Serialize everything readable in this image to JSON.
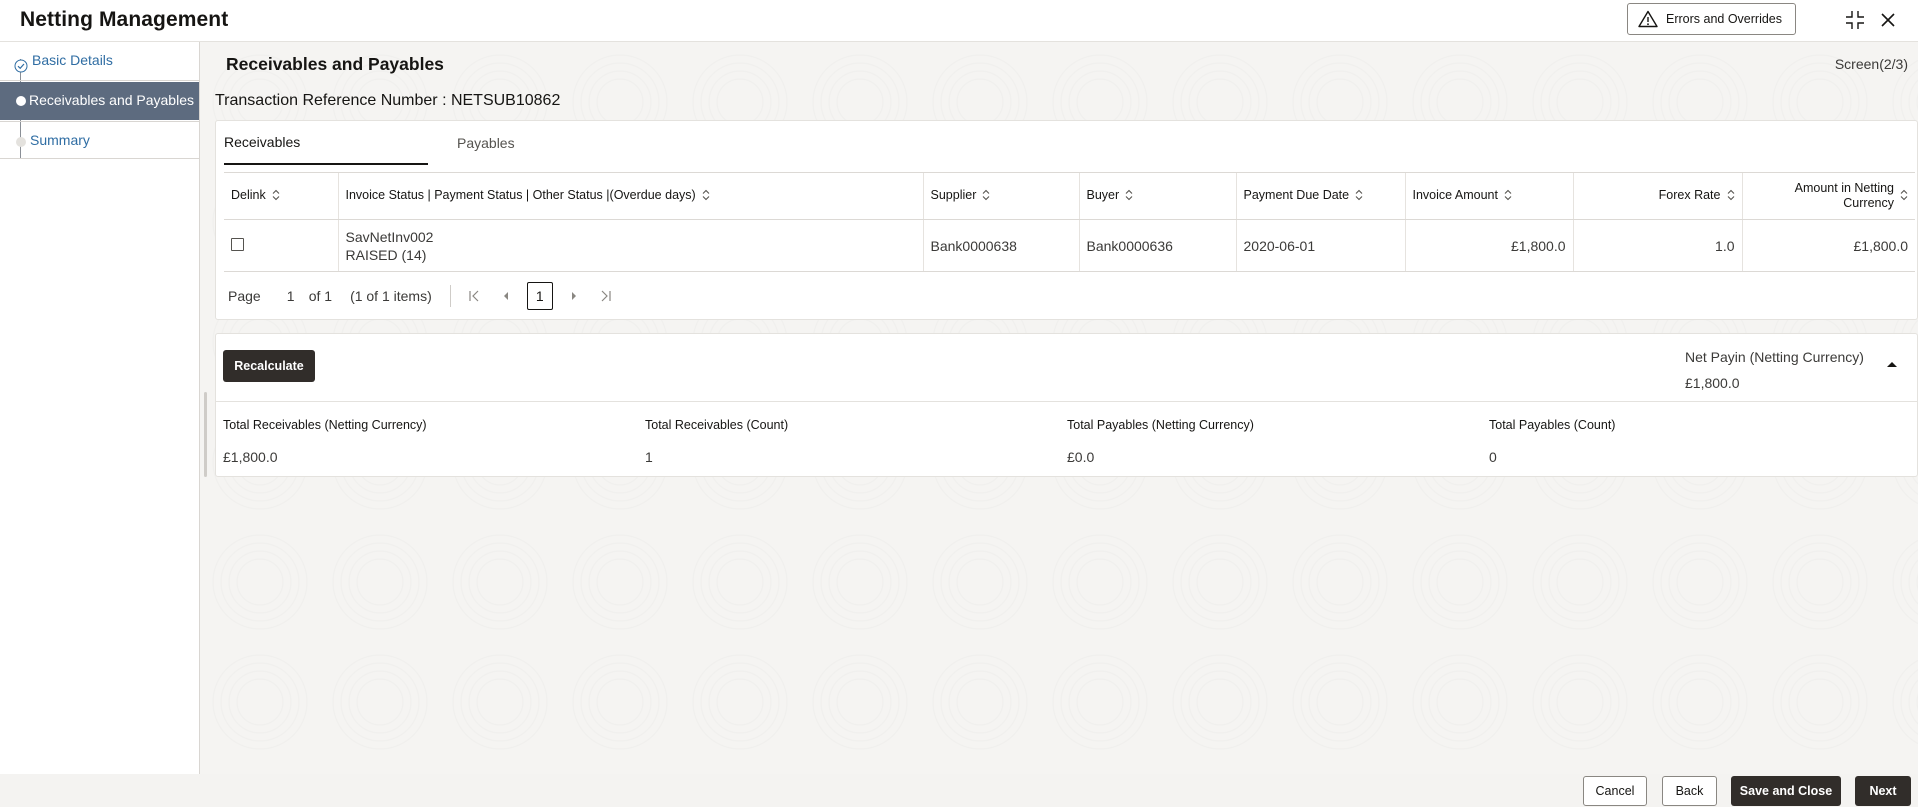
{
  "header": {
    "title": "Netting Management",
    "errors_label": "Errors and Overrides"
  },
  "sidebar": {
    "items": [
      {
        "label": "Basic Details",
        "state": "completed"
      },
      {
        "label": "Receivables and Payables",
        "state": "active"
      },
      {
        "label": "Summary",
        "state": "pending"
      }
    ]
  },
  "main": {
    "section_title": "Receivables and Payables",
    "screen_indicator": "Screen(2/3)",
    "transaction_reference": "Transaction Reference Number : NETSUB10862",
    "tabs": [
      {
        "label": "Receivables",
        "active": true
      },
      {
        "label": "Payables",
        "active": false
      }
    ],
    "table": {
      "columns": [
        "Delink",
        "Invoice Status | Payment Status | Other Status |(Overdue days)",
        "Supplier",
        "Buyer",
        "Payment Due Date",
        "Invoice Amount",
        "Forex Rate",
        "Amount in Netting Currency"
      ],
      "rows": [
        {
          "delink": false,
          "invoice_ref": "SavNetInv002",
          "status": "RAISED (14)",
          "supplier": "Bank0000638",
          "buyer": "Bank0000636",
          "payment_due_date": "2020-06-01",
          "invoice_amount": "£1,800.0",
          "forex_rate": "1.0",
          "amount_netting": "£1,800.0"
        }
      ]
    },
    "pagination": {
      "page_label": "Page",
      "page_value": "1",
      "of_label": "of 1",
      "items_label": "(1 of 1 items)",
      "current_page": "1"
    },
    "summary": {
      "recalculate_label": "Recalculate",
      "net_payin_label": "Net Payin (Netting Currency)",
      "net_payin_value": "£1,800.0",
      "totals": [
        {
          "label": "Total Receivables (Netting Currency)",
          "value": "£1,800.0"
        },
        {
          "label": "Total Receivables (Count)",
          "value": "1"
        },
        {
          "label": "Total Payables (Netting Currency)",
          "value": "£0.0"
        },
        {
          "label": "Total Payables (Count)",
          "value": "0"
        }
      ]
    }
  },
  "footer": {
    "cancel_label": "Cancel",
    "back_label": "Back",
    "save_close_label": "Save and Close",
    "next_label": "Next"
  },
  "colors": {
    "active_step_bg": "#5d6b7f",
    "link_blue": "#2f6da3",
    "primary_button": "#312d2a"
  }
}
